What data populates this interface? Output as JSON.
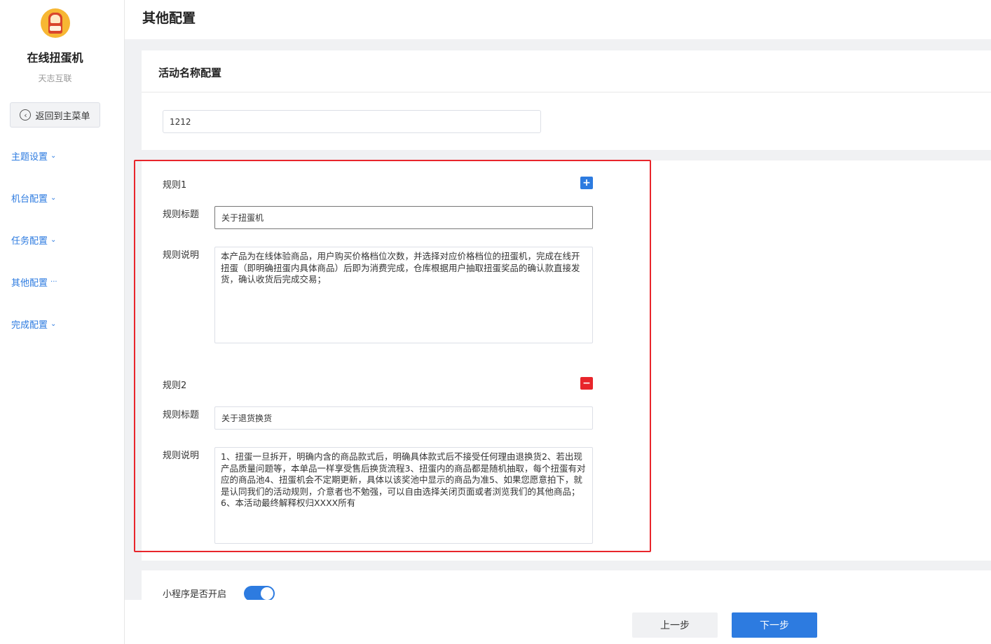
{
  "sidebar": {
    "app_name": "在线扭蛋机",
    "app_sub": "天志互联",
    "back_label": "返回到主菜单",
    "items": [
      {
        "label": "主题设置",
        "chev": "⌄"
      },
      {
        "label": "机台配置",
        "chev": "⌄"
      },
      {
        "label": "任务配置",
        "chev": "⌄"
      },
      {
        "label": "其他配置",
        "chev": "···"
      },
      {
        "label": "完成配置",
        "chev": "⌄"
      }
    ]
  },
  "header": {
    "title": "其他配置"
  },
  "activity": {
    "title": "活动名称配置",
    "name_value": "1212"
  },
  "rules": [
    {
      "label": "规则1",
      "title_label": "规则标题",
      "title_value": "关于扭蛋机",
      "desc_label": "规则说明",
      "desc_value": "本产品为在线体验商品，用户购买价格档位次数，并选择对应价格档位的扭蛋机，完成在线开扭蛋（即明确扭蛋内具体商品）后即为消费完成，仓库根据用户抽取扭蛋奖品的确认款直接发货，确认收货后完成交易；",
      "action": "+"
    },
    {
      "label": "规则2",
      "title_label": "规则标题",
      "title_value": "关于退货换货",
      "desc_label": "规则说明",
      "desc_value": "1、扭蛋一旦拆开，明确内含的商品款式后，明确具体款式后不接受任何理由退换货2、若出现产品质量问题等，本单品一样享受售后换货流程3、扭蛋内的商品都是随机抽取，每个扭蛋有对应的商品池4、扭蛋机会不定期更新，具体以该奖池中显示的商品为准5、如果您愿意拍下，就是认同我们的活动规则，介意者也不勉强，可以自由选择关闭页面或者浏览我们的其他商品；6、本活动最终解释权归XXXX所有",
      "action": "−"
    }
  ],
  "miniprogram": {
    "label": "小程序是否开启",
    "enabled": true
  },
  "footer": {
    "prev_label": "上一步",
    "next_label": "下一步"
  },
  "colors": {
    "accent": "#2d7be0",
    "danger": "#e8252b",
    "highlight": "#e8252b"
  }
}
